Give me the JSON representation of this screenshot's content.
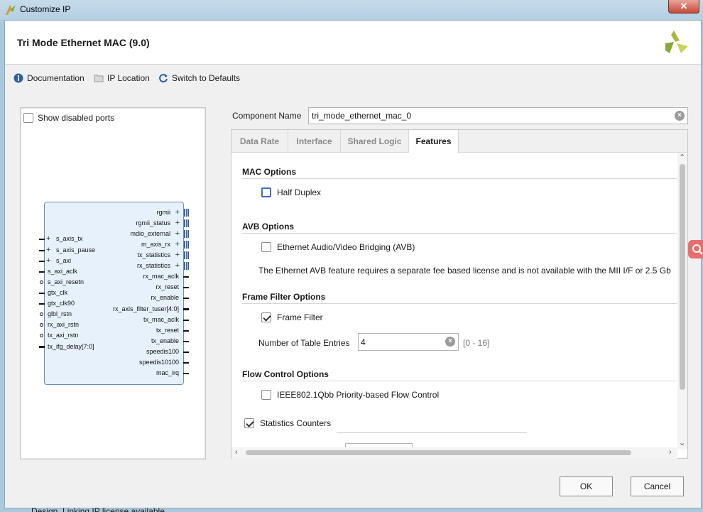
{
  "window": {
    "title": "Customize IP",
    "close_glyph": "✕"
  },
  "header": {
    "ip_title": "Tri Mode Ethernet MAC (9.0)",
    "brand_logo": "xilinx-logo"
  },
  "toolbar": {
    "documentation": "Documentation",
    "ip_location": "IP Location",
    "switch_defaults": "Switch to Defaults"
  },
  "symbol": {
    "show_disabled_ports": "Show disabled ports",
    "left_ports": [
      "s_axis_tx",
      "s_axis_pause",
      "s_axi",
      "s_axi_aclk",
      "s_axi_resetn",
      "gtx_clk",
      "gtx_clk90",
      "glbl_rstn",
      "rx_axi_rstn",
      "tx_axi_rstn",
      "tx_ifg_delay[7:0]"
    ],
    "right_ports": [
      "rgmii",
      "rgmii_status",
      "mdio_external",
      "m_axis_rx",
      "tx_statistics",
      "rx_statistics",
      "rx_mac_aclk",
      "rx_reset",
      "rx_enable",
      "rx_axis_filter_tuser[4:0]",
      "tx_mac_aclk",
      "tx_reset",
      "tx_enable",
      "speedis100",
      "speedis10100",
      "mac_irq"
    ]
  },
  "component": {
    "label": "Component Name",
    "value": "tri_mode_ethernet_mac_0"
  },
  "tabs": [
    "Data Rate",
    "Interface",
    "Shared Logic",
    "Features"
  ],
  "active_tab": "Features",
  "features": {
    "mac_options": {
      "title": "MAC Options",
      "half_duplex": "Half Duplex",
      "half_duplex_checked": false
    },
    "avb_options": {
      "title": "AVB Options",
      "avb_label": "Ethernet Audio/Video Bridging (AVB)",
      "avb_checked": false,
      "note": "The Ethernet AVB feature requires a separate fee based license and is not available with the MII I/F or 2.5 Gb"
    },
    "frame_filter": {
      "title": "Frame Filter Options",
      "label": "Frame Filter",
      "checked": true,
      "table_entries_label": "Number of Table Entries",
      "table_entries_value": "4",
      "range": "[0 - 16]"
    },
    "flow_control": {
      "title": "Flow Control Options",
      "label": "IEEE802.1Qbb Priority-based Flow Control",
      "checked": false
    },
    "statistics": {
      "label": "Statistics Counters",
      "checked": true
    }
  },
  "footer": {
    "license": "Design_Linking IP license available",
    "ok": "OK",
    "cancel": "Cancel"
  }
}
